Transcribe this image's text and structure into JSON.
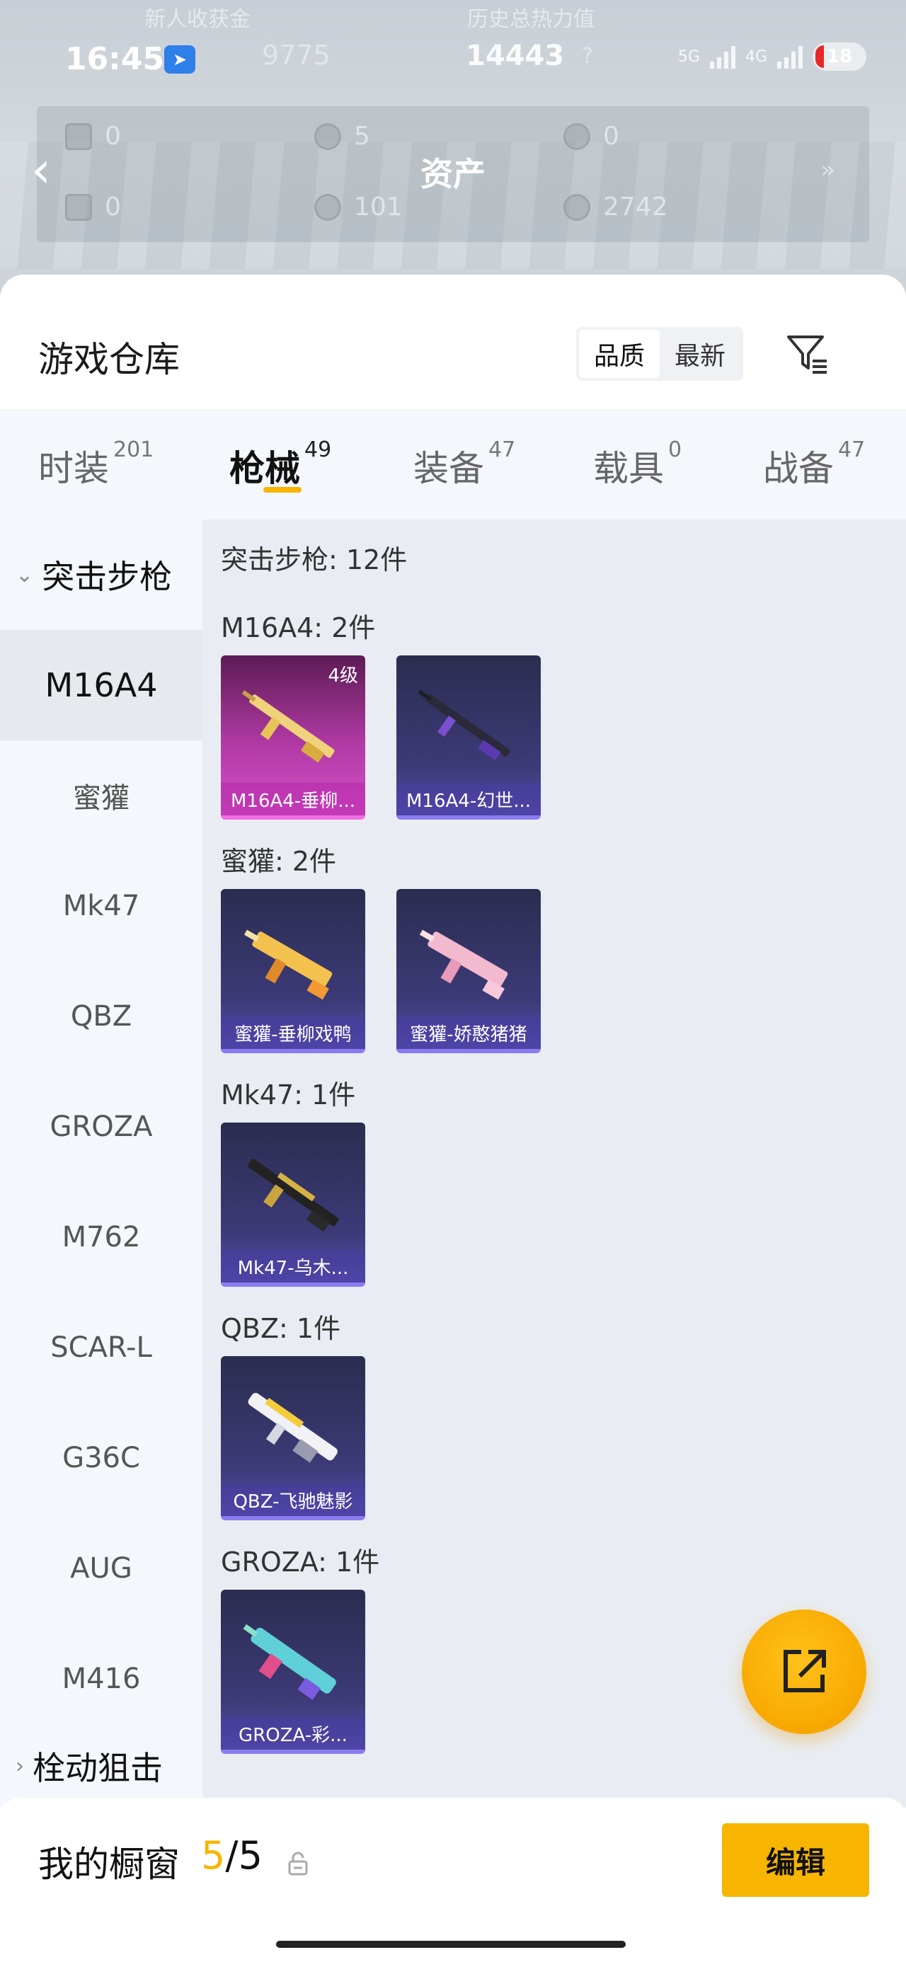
{
  "status_bar": {
    "time": "16:45",
    "app_badge_icon": "feishu-app-icon",
    "network_1": "5G",
    "network_2": "4G",
    "battery": "18"
  },
  "assets_header": {
    "faint_label_1": "新人收获金",
    "faint_label_2": "历史总热力值",
    "faint_value_1": "9775",
    "hot_value": "14443",
    "help_mark": "?",
    "title": "资产",
    "items": [
      {
        "icon": "card-icon",
        "value": "0"
      },
      {
        "icon": "coin-icon",
        "value": "5"
      },
      {
        "icon": "badge-icon",
        "value": "0"
      },
      {
        "icon": "card-green-icon",
        "value": "0"
      },
      {
        "icon": "orb-icon",
        "value": "101"
      },
      {
        "icon": "medal-icon",
        "value": "2742"
      }
    ]
  },
  "sheet": {
    "title": "游戏仓库",
    "sort_options": [
      "品质",
      "最新"
    ],
    "active_sort": "品质"
  },
  "tabs": [
    {
      "label": "时装",
      "count": "201"
    },
    {
      "label": "枪械",
      "count": "49"
    },
    {
      "label": "装备",
      "count": "47"
    },
    {
      "label": "载具",
      "count": "0"
    },
    {
      "label": "战备",
      "count": "47"
    }
  ],
  "active_tab": "枪械",
  "sidebar": {
    "group": "突击步枪",
    "items": [
      "M16A4",
      "蜜獾",
      "Mk47",
      "QBZ",
      "GROZA",
      "M762",
      "SCAR-L",
      "G36C",
      "AUG",
      "M416"
    ],
    "active_item": "M16A4",
    "next_group": "栓动狙击"
  },
  "main": {
    "category_header": "突击步枪: 12件",
    "groups": [
      {
        "title": "M16A4: 2件",
        "cards": [
          {
            "label": "M16A4-垂柳...",
            "level": "4级",
            "style": "pink"
          },
          {
            "label": "M16A4-幻世...",
            "level": "",
            "style": "purple"
          }
        ]
      },
      {
        "title": "蜜獾: 2件",
        "cards": [
          {
            "label": "蜜獾-垂柳戏鸭",
            "level": "",
            "style": "purple"
          },
          {
            "label": "蜜獾-娇憨猪猪",
            "level": "",
            "style": "purple"
          }
        ]
      },
      {
        "title": "Mk47: 1件",
        "cards": [
          {
            "label": "Mk47-乌木...",
            "level": "",
            "style": "purple"
          }
        ]
      },
      {
        "title": "QBZ: 1件",
        "cards": [
          {
            "label": "QBZ-飞驰魅影",
            "level": "",
            "style": "purple"
          }
        ]
      },
      {
        "title": "GROZA: 1件",
        "cards": [
          {
            "label": "GROZA-彩...",
            "level": "",
            "style": "purple"
          }
        ]
      }
    ]
  },
  "bottom_bar": {
    "label": "我的橱窗",
    "current": "5",
    "separator": "/",
    "total": "5",
    "edit_label": "编辑"
  },
  "colors": {
    "accent": "#f7b500",
    "card_purple": "#3d3a78",
    "card_pink": "#b03aa4"
  }
}
